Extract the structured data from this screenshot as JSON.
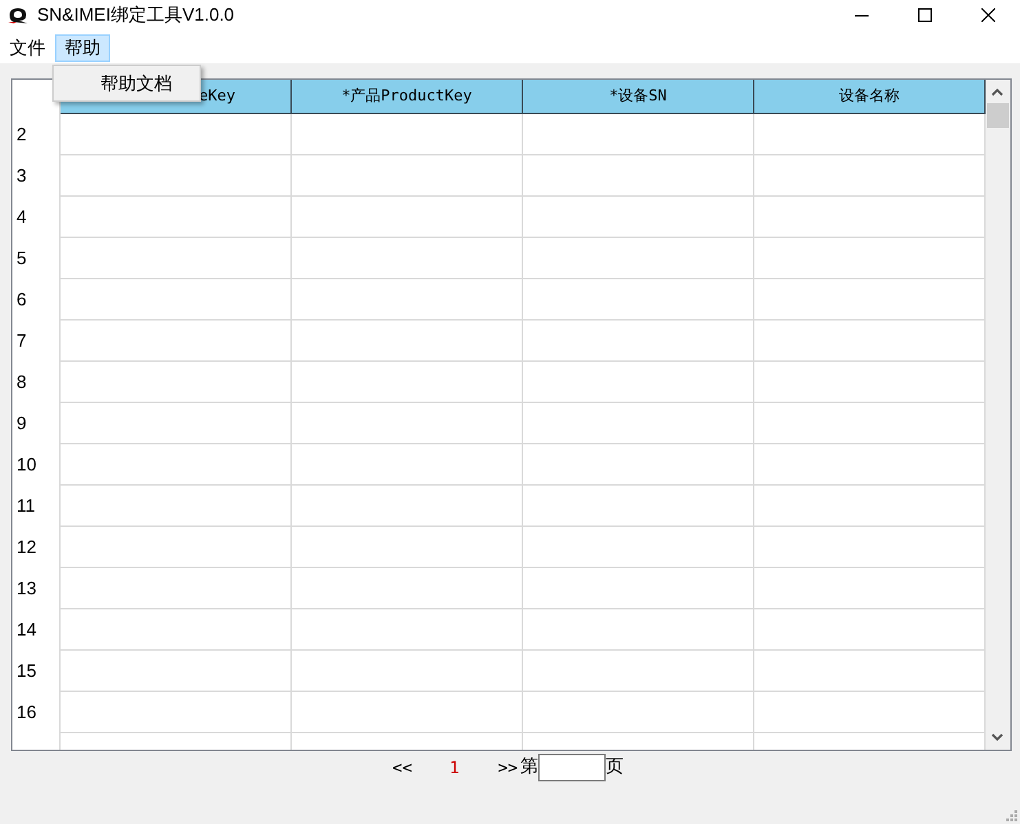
{
  "window": {
    "title": "SN&IMEI绑定工具V1.0.0"
  },
  "menu_bar": [
    {
      "label": "文件",
      "selected": false
    },
    {
      "label": "帮助",
      "selected": true
    }
  ],
  "open_menu": {
    "items": [
      "帮助文档"
    ]
  },
  "table": {
    "columns": [
      "eKey",
      "*产品ProductKey",
      "*设备SN",
      "设备名称"
    ],
    "rows": [
      "2",
      "3",
      "4",
      "5",
      "6",
      "7",
      "8",
      "9",
      "10",
      "11",
      "12",
      "13",
      "14",
      "15",
      "16"
    ]
  },
  "pagination": {
    "prev": "<<",
    "current": "1",
    "next": ">>",
    "page_prefix": "第",
    "page_suffix": "页"
  }
}
